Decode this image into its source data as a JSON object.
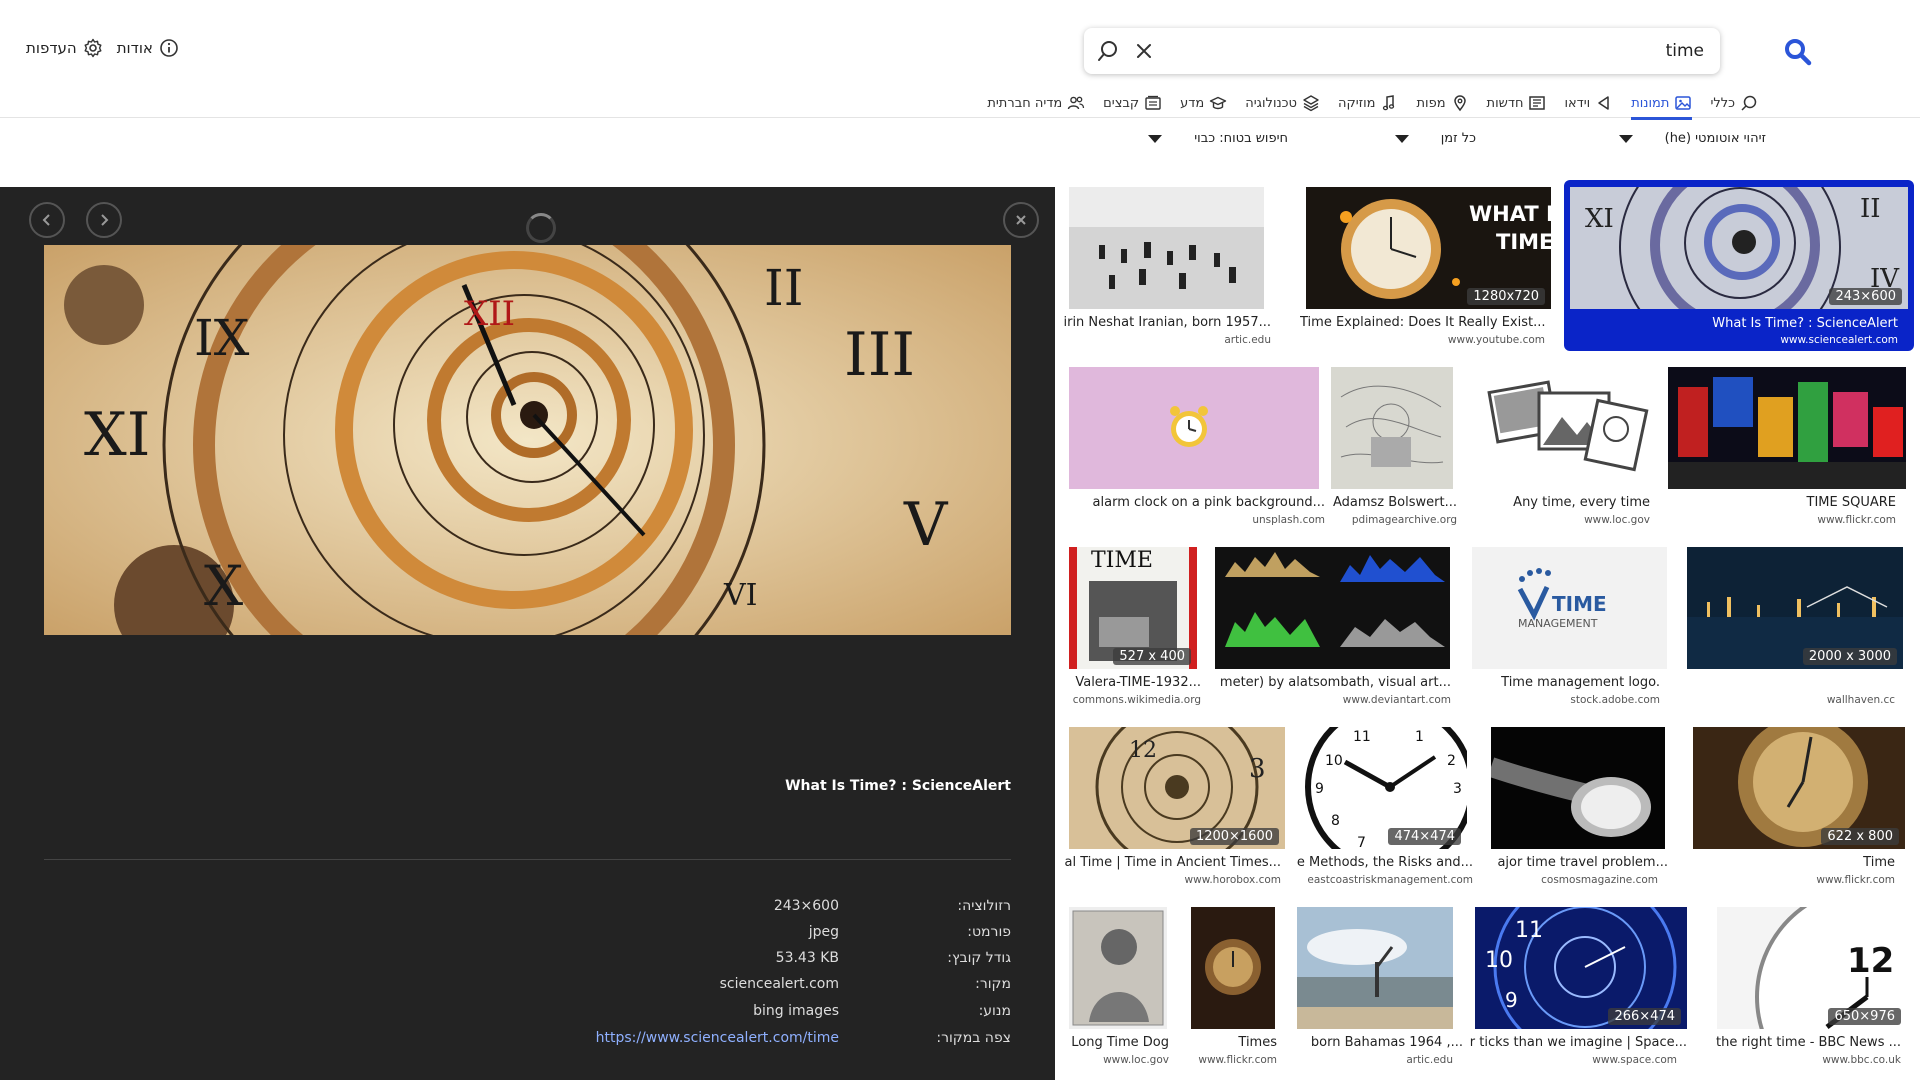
{
  "search": {
    "query": "time"
  },
  "header": {
    "settings_label": "העדפות",
    "about_label": "אודות"
  },
  "tabs": [
    {
      "label": "כללי",
      "icon": "search-icon"
    },
    {
      "label": "תמונות",
      "icon": "image-icon",
      "active": true
    },
    {
      "label": "וידאו",
      "icon": "play-icon"
    },
    {
      "label": "חדשות",
      "icon": "news-icon"
    },
    {
      "label": "מפות",
      "icon": "map-pin-icon"
    },
    {
      "label": "מוזיקה",
      "icon": "music-icon"
    },
    {
      "label": "טכנולוגיה",
      "icon": "layers-icon"
    },
    {
      "label": "מדע",
      "icon": "graduation-icon"
    },
    {
      "label": "קבצים",
      "icon": "files-icon"
    },
    {
      "label": "מדיה חברתית",
      "icon": "people-icon"
    }
  ],
  "filters": {
    "language": "זיהוי אוטומטי (he)",
    "time": "כל זמן",
    "safe": "חיפוש בטוח: כבוי"
  },
  "preview": {
    "title": "What Is Time? : ScienceAlert",
    "meta": [
      {
        "key": "רזולוציה:",
        "value": "243×600"
      },
      {
        "key": "פורמט:",
        "value": "jpeg"
      },
      {
        "key": "גודל קובץ:",
        "value": "53.43 KB"
      },
      {
        "key": "מקור:",
        "value": "sciencealert.com"
      },
      {
        "key": "מנוע:",
        "value": "bing images"
      },
      {
        "key": "צפה במקור:",
        "value": "https://www.sciencealert.com/time",
        "link": true
      }
    ]
  },
  "results": [
    {
      "caption": "irin Neshat Iranian, born 1957...",
      "source": "artic.edu",
      "dim": ""
    },
    {
      "caption": "Time Explained: Does It Really Exist...",
      "source": "www.youtube.com",
      "dim": "1280x720",
      "overlay": "WHAT IS TIME"
    },
    {
      "caption": "What Is Time? : ScienceAlert",
      "source": "www.sciencealert.com",
      "dim": "243×600"
    },
    {
      "caption": "alarm clock on a pink background...",
      "source": "unsplash.com",
      "dim": ""
    },
    {
      "caption": "Adamsz Bolswert...",
      "source": "pdimagearchive.org",
      "dim": ""
    },
    {
      "caption": "Any time, every time",
      "source": "www.loc.gov",
      "dim": ""
    },
    {
      "caption": "TIME SQUARE",
      "source": "www.flickr.com",
      "dim": ""
    },
    {
      "caption": "Valera-TIME-1932...",
      "source": "commons.wikimedia.org",
      "dim": "527 x 400",
      "overlay": "TIME"
    },
    {
      "caption": "meter) by alatsombath, visual art...",
      "source": "www.deviantart.com",
      "dim": ""
    },
    {
      "caption": "Time management logo.",
      "source": "stock.adobe.com",
      "dim": "",
      "overlay": "TIME MANAGEMENT"
    },
    {
      "caption": "",
      "source": "wallhaven.cc",
      "dim": "2000 x 3000"
    },
    {
      "caption": "al Time | Time in Ancient Times...",
      "source": "www.horobox.com",
      "dim": "1200×1600"
    },
    {
      "caption": "e Methods, the Risks and...",
      "source": "eastcoastriskmanagement.com",
      "dim": "474×474"
    },
    {
      "caption": "ajor time travel problem...",
      "source": "cosmosmagazine.com",
      "dim": ""
    },
    {
      "caption": "Time",
      "source": "www.flickr.com",
      "dim": "622 x 800"
    },
    {
      "caption": "Long Time Dog",
      "source": "www.loc.gov",
      "dim": ""
    },
    {
      "caption": "Times",
      "source": "www.flickr.com",
      "dim": ""
    },
    {
      "caption": "born Bahamas 1964 ,...",
      "source": "artic.edu",
      "dim": ""
    },
    {
      "caption": "r ticks than we imagine | Space...",
      "source": "www.space.com",
      "dim": "266×474"
    },
    {
      "caption": "the right time - BBC News ...",
      "source": "www.bbc.co.uk",
      "dim": "650×976"
    }
  ],
  "colors": {
    "accent": "#2b55d8",
    "selected": "#0a24c8",
    "panel": "#232323"
  }
}
